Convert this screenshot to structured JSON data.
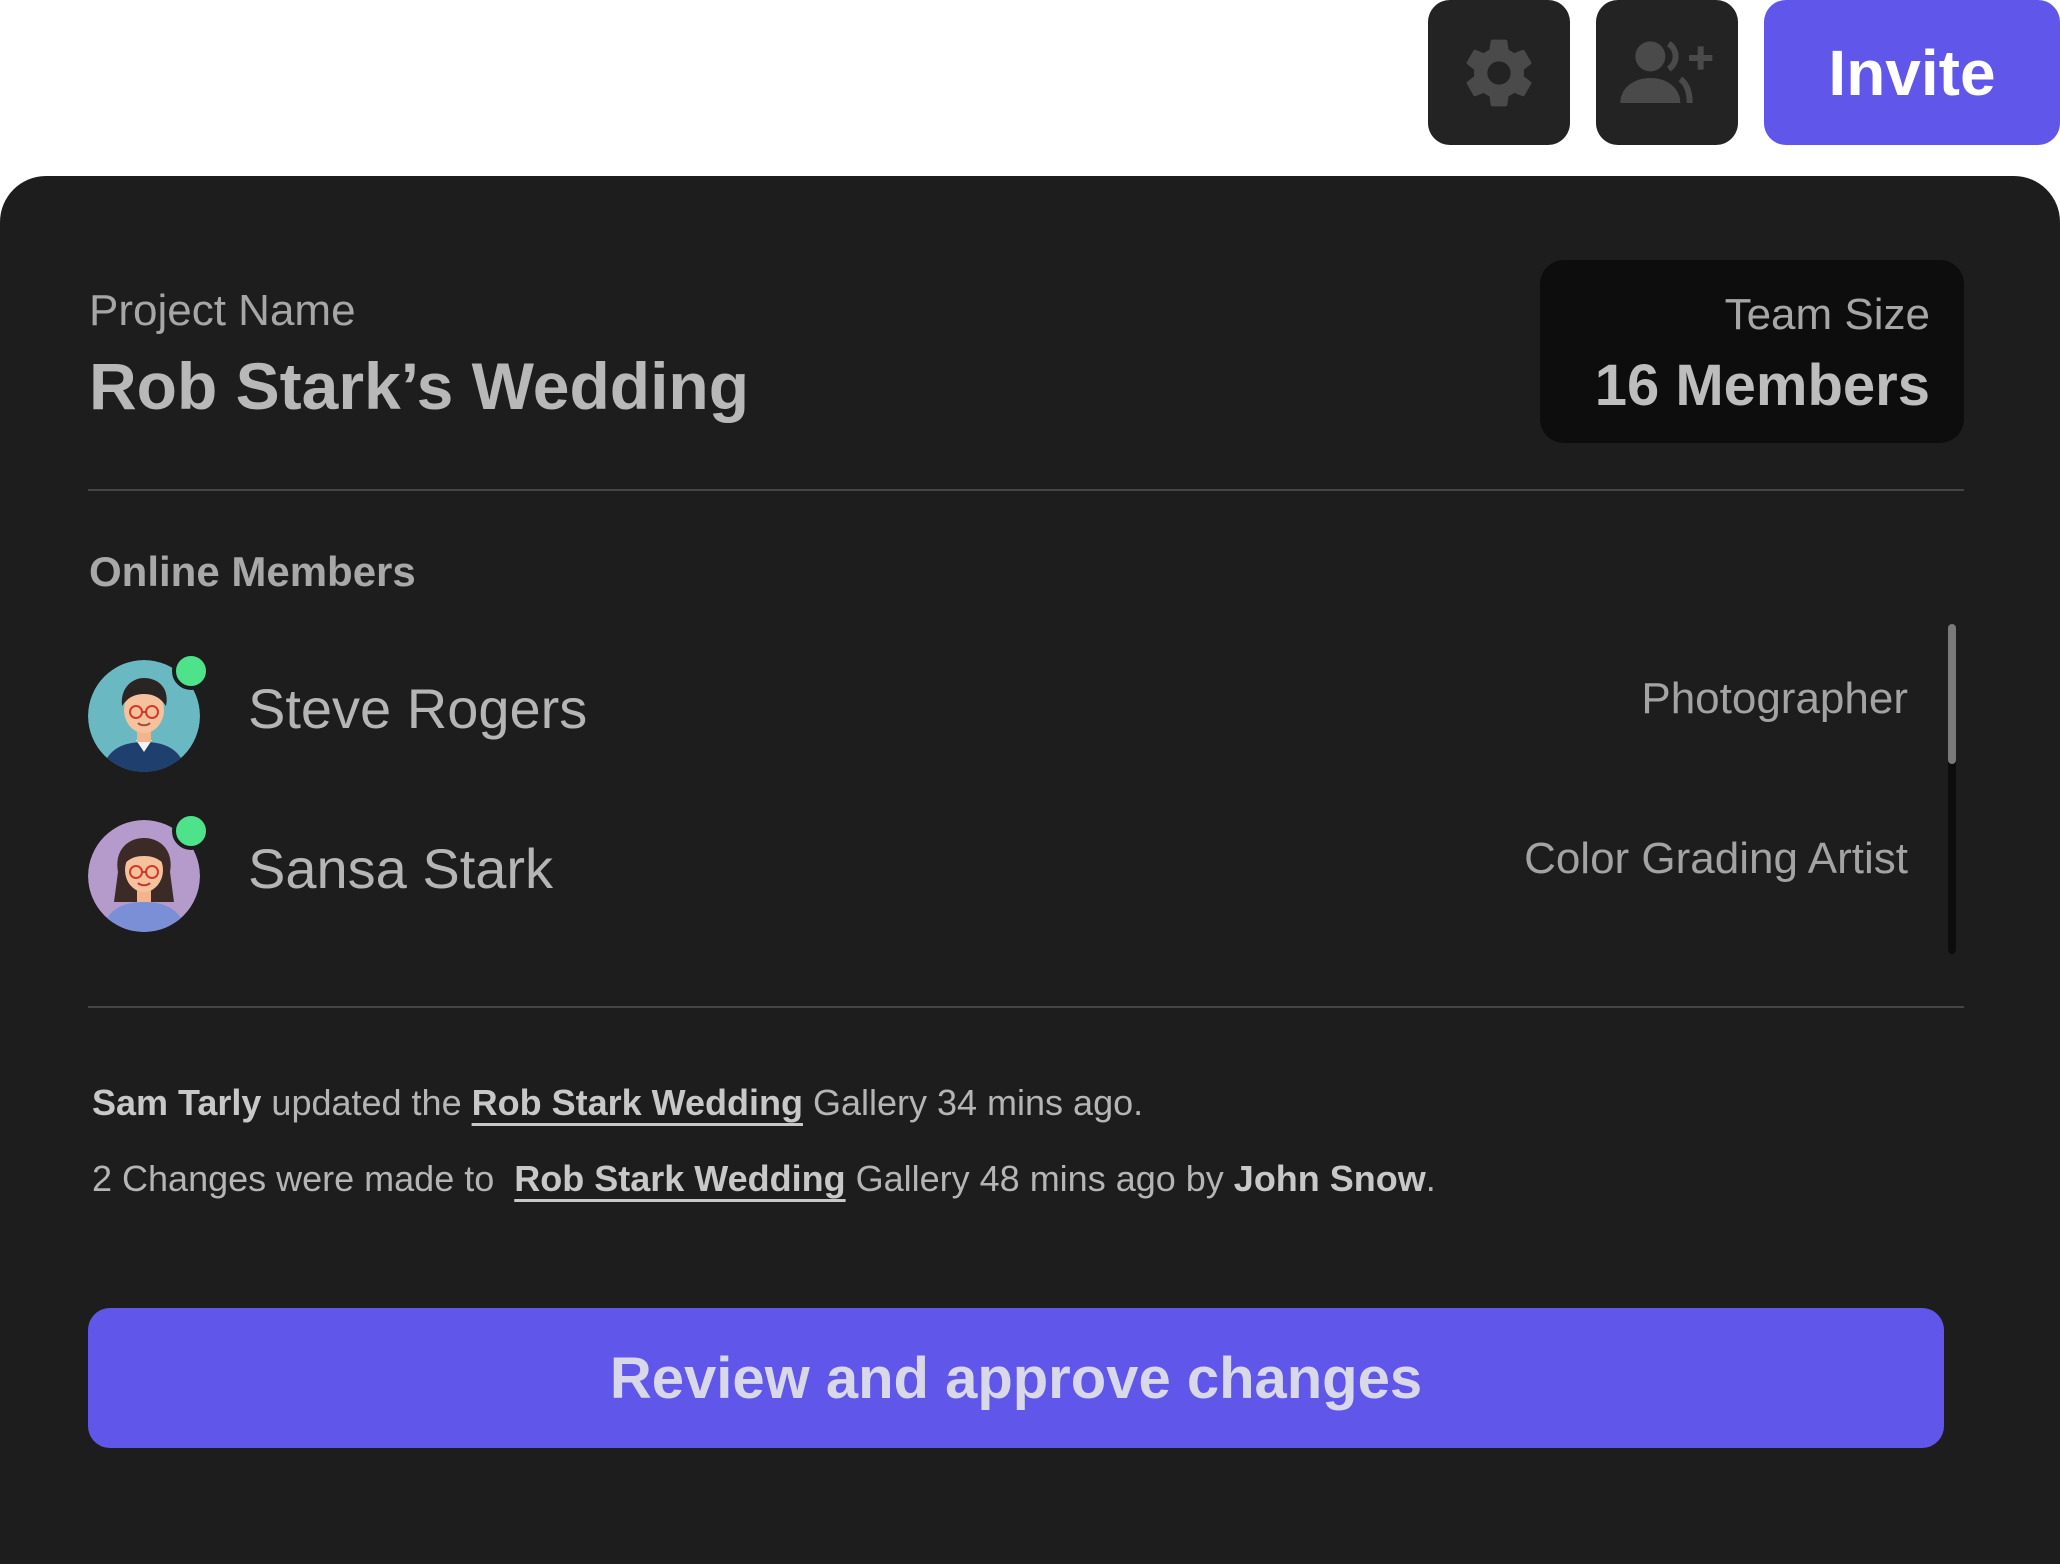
{
  "toolbar": {
    "settings_icon": "gear-icon",
    "add_member_icon": "user-plus-icon",
    "invite_label": "Invite"
  },
  "project": {
    "label": "Project Name",
    "name": "Rob Stark’s Wedding"
  },
  "team": {
    "label": "Team Size",
    "size": "16 Members"
  },
  "online": {
    "title": "Online Members",
    "members": [
      {
        "name": "Steve Rogers",
        "role": "Photographer",
        "avatar_bg": "#6ab9c2",
        "status": "online"
      },
      {
        "name": "Sansa Stark",
        "role": "Color Grading Artist",
        "avatar_bg": "#b49bcc",
        "status": "online"
      }
    ]
  },
  "activity": [
    {
      "actor": "Sam Tarly",
      "text1": " updated the ",
      "link": "Rob Stark Wedding",
      "text2": " Gallery 34 mins ago."
    },
    {
      "text1": "2 Changes were made to  ",
      "link": "Rob Stark Wedding",
      "text2": " Gallery 48 mins ago by ",
      "actor": "John Snow",
      "text3": "."
    }
  ],
  "review_button": "Review and approve changes",
  "colors": {
    "accent": "#6057ea",
    "card_bg": "#1d1d1d",
    "online": "#4ee38a"
  }
}
